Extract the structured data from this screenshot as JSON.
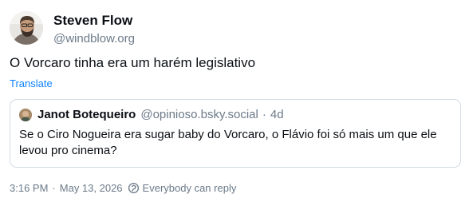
{
  "post": {
    "author": {
      "display_name": "Steven Flow",
      "handle": "@windblow.org"
    },
    "text": "O Vorcaro tinha era um harém legislativo",
    "translate_label": "Translate",
    "quote": {
      "author_name": "Janot Botequeiro",
      "author_handle": "@opinioso.bsky.social",
      "separator": "·",
      "time_ago": "4d",
      "text": "Se o Ciro Nogueira era sugar baby do Vorcaro, o Flávio foi só mais um que ele levou pro cinema?"
    },
    "meta": {
      "time": "3:16 PM",
      "separator": "·",
      "date": "May 13, 2026",
      "reply_icon": "globe-reply-icon",
      "reply_setting": "Everybody can reply"
    }
  },
  "colors": {
    "text": "#0b0f14",
    "muted": "#6b7a89",
    "link": "#1083fe",
    "border": "#d4dbe2"
  }
}
